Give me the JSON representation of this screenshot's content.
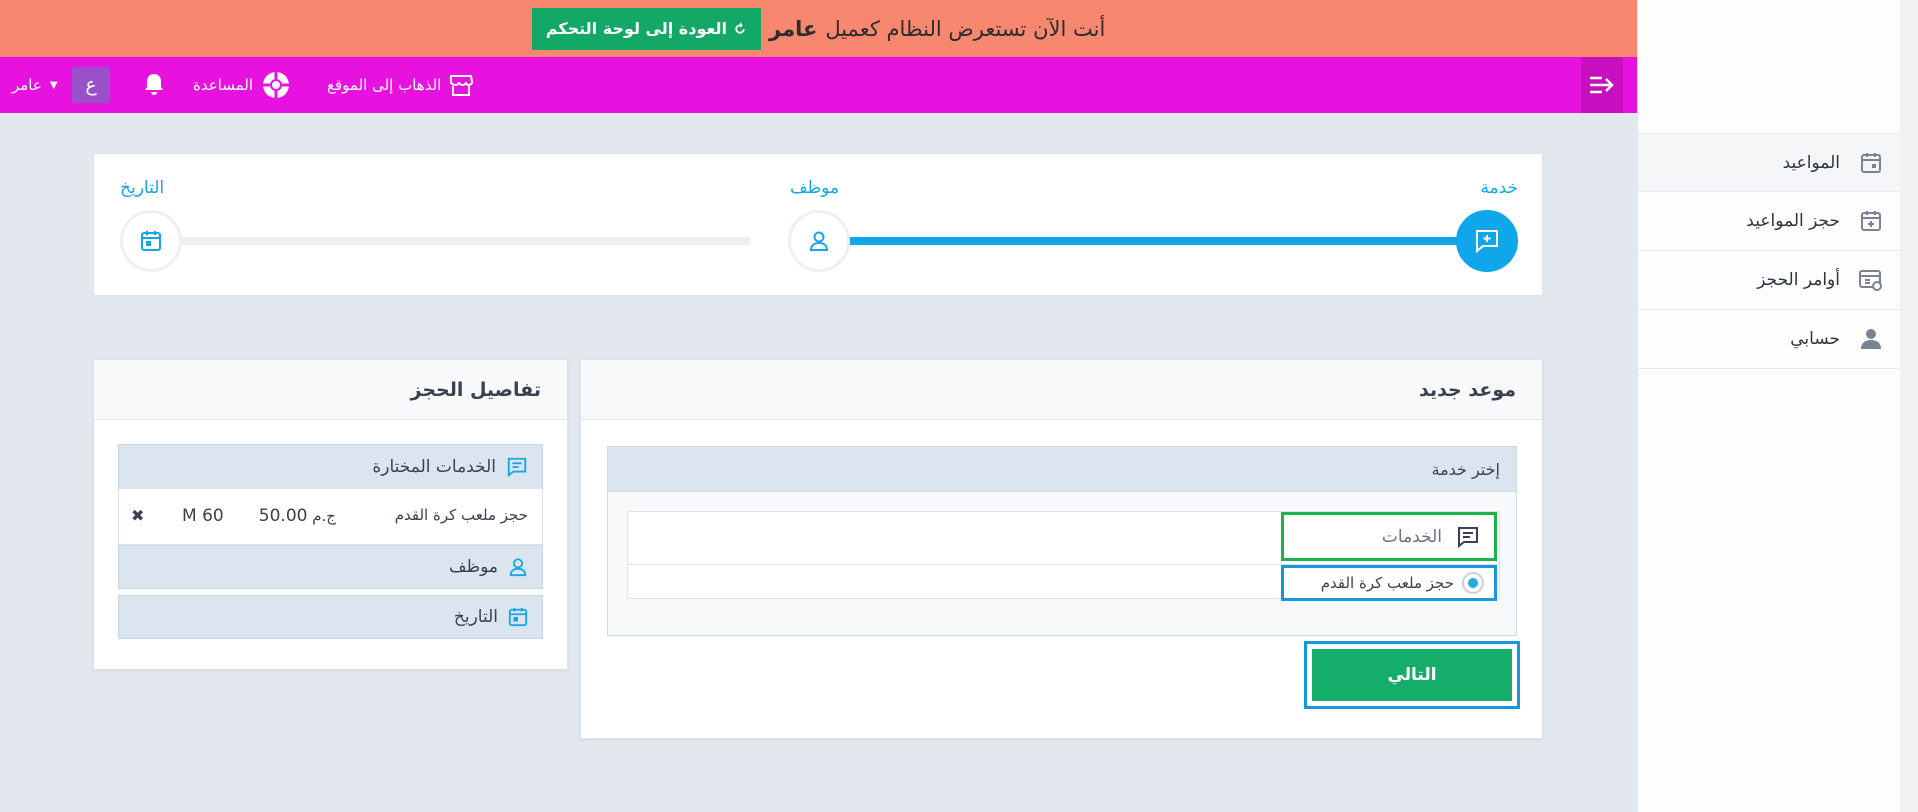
{
  "impersonation": {
    "message": "أنت الآن تستعرض النظام كعميل",
    "customer_name": "عامر",
    "back_label": "العودة إلى لوحة التحكم"
  },
  "topnav": {
    "go_to_site": "الذهاب إلى الموقع",
    "help": "المساعدة",
    "avatar_letter": "ع",
    "user_name": "عامر"
  },
  "sidebar": {
    "items": [
      {
        "label": "المواعيد",
        "icon": "calendar-icon"
      },
      {
        "label": "حجز المواعيد",
        "icon": "calendar-plus-icon"
      },
      {
        "label": "أوامر الحجز",
        "icon": "orders-icon"
      },
      {
        "label": "حسابي",
        "icon": "user-icon"
      }
    ]
  },
  "steps": [
    {
      "label": "خدمة",
      "icon": "service-icon",
      "active": true
    },
    {
      "label": "موظف",
      "icon": "user-icon",
      "active": false
    },
    {
      "label": "التاريخ",
      "icon": "calendar-icon",
      "active": false
    }
  ],
  "appointment": {
    "title": "موعد جديد",
    "choose_service": "إختر خدمة",
    "services_header": "الخدمات",
    "service_option": "حجز ملعب كرة القدم",
    "next_label": "التالي"
  },
  "details": {
    "title": "تفاصيل الحجز",
    "selected_services": "الخدمات المختارة",
    "service_name": "حجز ملعب كرة القدم",
    "price": "50.00",
    "currency": "ج.م",
    "duration": "M 60",
    "employee": "موظف",
    "date": "التاريخ",
    "remove_symbol": "✖"
  },
  "colors": {
    "impersonation_bg": "#f7876f",
    "nav_bg": "#e812e0",
    "accent_blue": "#0fa7e9",
    "green": "#14ad6a"
  }
}
